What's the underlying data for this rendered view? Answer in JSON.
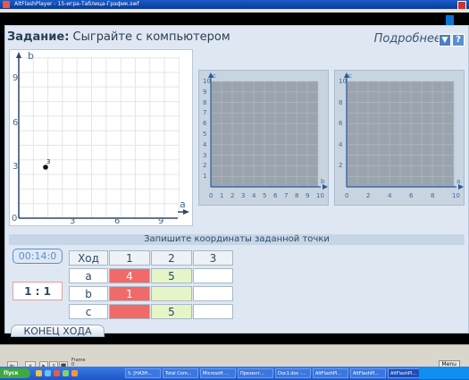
{
  "window": {
    "title": "AltFlashPlayer - 15-игра-Таблица-График.swf"
  },
  "header": {
    "task_label": "Задание:",
    "task_text": "Сыграйте с компьютером",
    "details": "Подробнее",
    "dropdown_glyph": "▼",
    "help_glyph": "?"
  },
  "main_graph": {
    "y_axis_label": "b",
    "x_axis_label": "a",
    "y_ticks": [
      "9",
      "6",
      "3"
    ],
    "x_ticks": [
      "3",
      "6",
      "9"
    ],
    "origin": "0",
    "point_label": "3"
  },
  "graph_c_b": {
    "y_axis_label": "c",
    "x_axis_label": "b",
    "y_ticks": [
      "10",
      "9",
      "8",
      "7",
      "6",
      "5",
      "4",
      "3",
      "2",
      "1"
    ],
    "x_ticks": [
      "0",
      "1",
      "2",
      "3",
      "4",
      "5",
      "6",
      "7",
      "8",
      "9",
      "10"
    ]
  },
  "graph_c_a": {
    "y_axis_label": "c",
    "x_axis_label": "a",
    "y_ticks": [
      "10",
      "8",
      "6",
      "4",
      "2"
    ],
    "x_ticks": [
      "0",
      "2",
      "4",
      "6",
      "8",
      "10"
    ]
  },
  "instruction": "Запишите координаты заданной точки",
  "timer": "00:14:0",
  "score": "1 : 1",
  "table": {
    "headers": [
      "Ход",
      "1",
      "2",
      "3"
    ],
    "rows": [
      {
        "label": "a",
        "cells": [
          "4",
          "5",
          ""
        ]
      },
      {
        "label": "b",
        "cells": [
          "1",
          "",
          ""
        ]
      },
      {
        "label": "c",
        "cells": [
          "",
          "5",
          ""
        ]
      }
    ]
  },
  "end_turn_button": "КОНЕЦ ХОДА",
  "player": {
    "frame_label": "Frame",
    "frame_value": "0",
    "menu_label": "Menu"
  },
  "taskbar": {
    "start_label": "Пуск",
    "buttons": [
      "5. [НАЗН...",
      "Total Com...",
      "Microsoft ...",
      "Презент...",
      "Doc1.doc -...",
      "AltFlashPl...",
      "AltFlashPl...",
      "AltFlashPl..."
    ]
  },
  "colors": {
    "accent_blue": "#4a7fc0",
    "cell_red": "#f06a6a",
    "cell_lime": "#e6f5c8"
  }
}
